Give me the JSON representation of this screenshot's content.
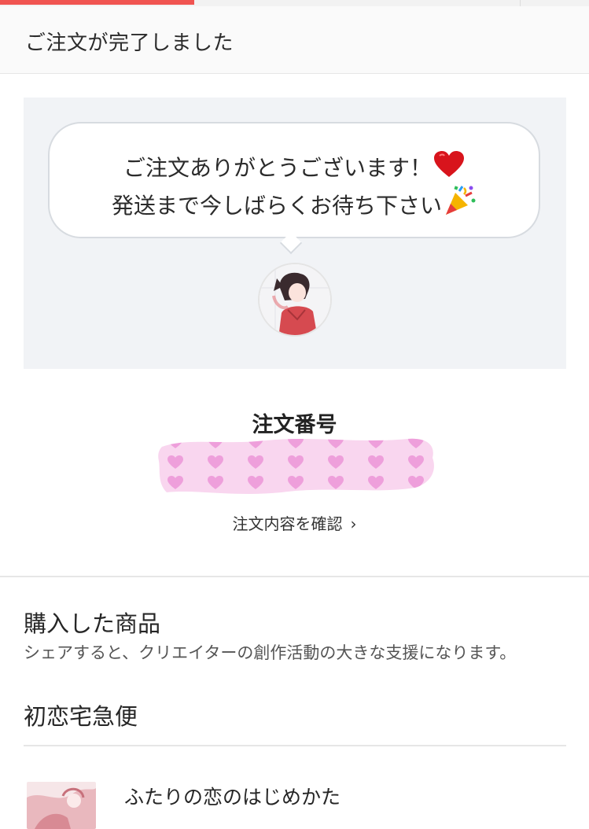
{
  "progress": {
    "fraction": 0.33,
    "color": "#f05451"
  },
  "header": {
    "title": "ご注文が完了しました"
  },
  "hero": {
    "message_line1": "ご注文ありがとうございます！",
    "message_line2": "発送まで今しばらくお待ち下さい",
    "line1_emoji": "heart-icon",
    "line2_emoji": "party-popper-icon"
  },
  "order": {
    "label": "注文番号",
    "confirm_link": "注文内容を確認"
  },
  "purchased": {
    "title": "購入した商品",
    "note": "シェアすると、クリエイターの創作活動の大きな支援になります。",
    "shop_name": "初恋宅急便",
    "items": [
      {
        "name": "ふたりの恋のはじめかた"
      }
    ]
  },
  "colors": {
    "accent": "#f05451",
    "panel_bg": "#f1f3f6",
    "redaction_pink": "#f7c9ea"
  }
}
